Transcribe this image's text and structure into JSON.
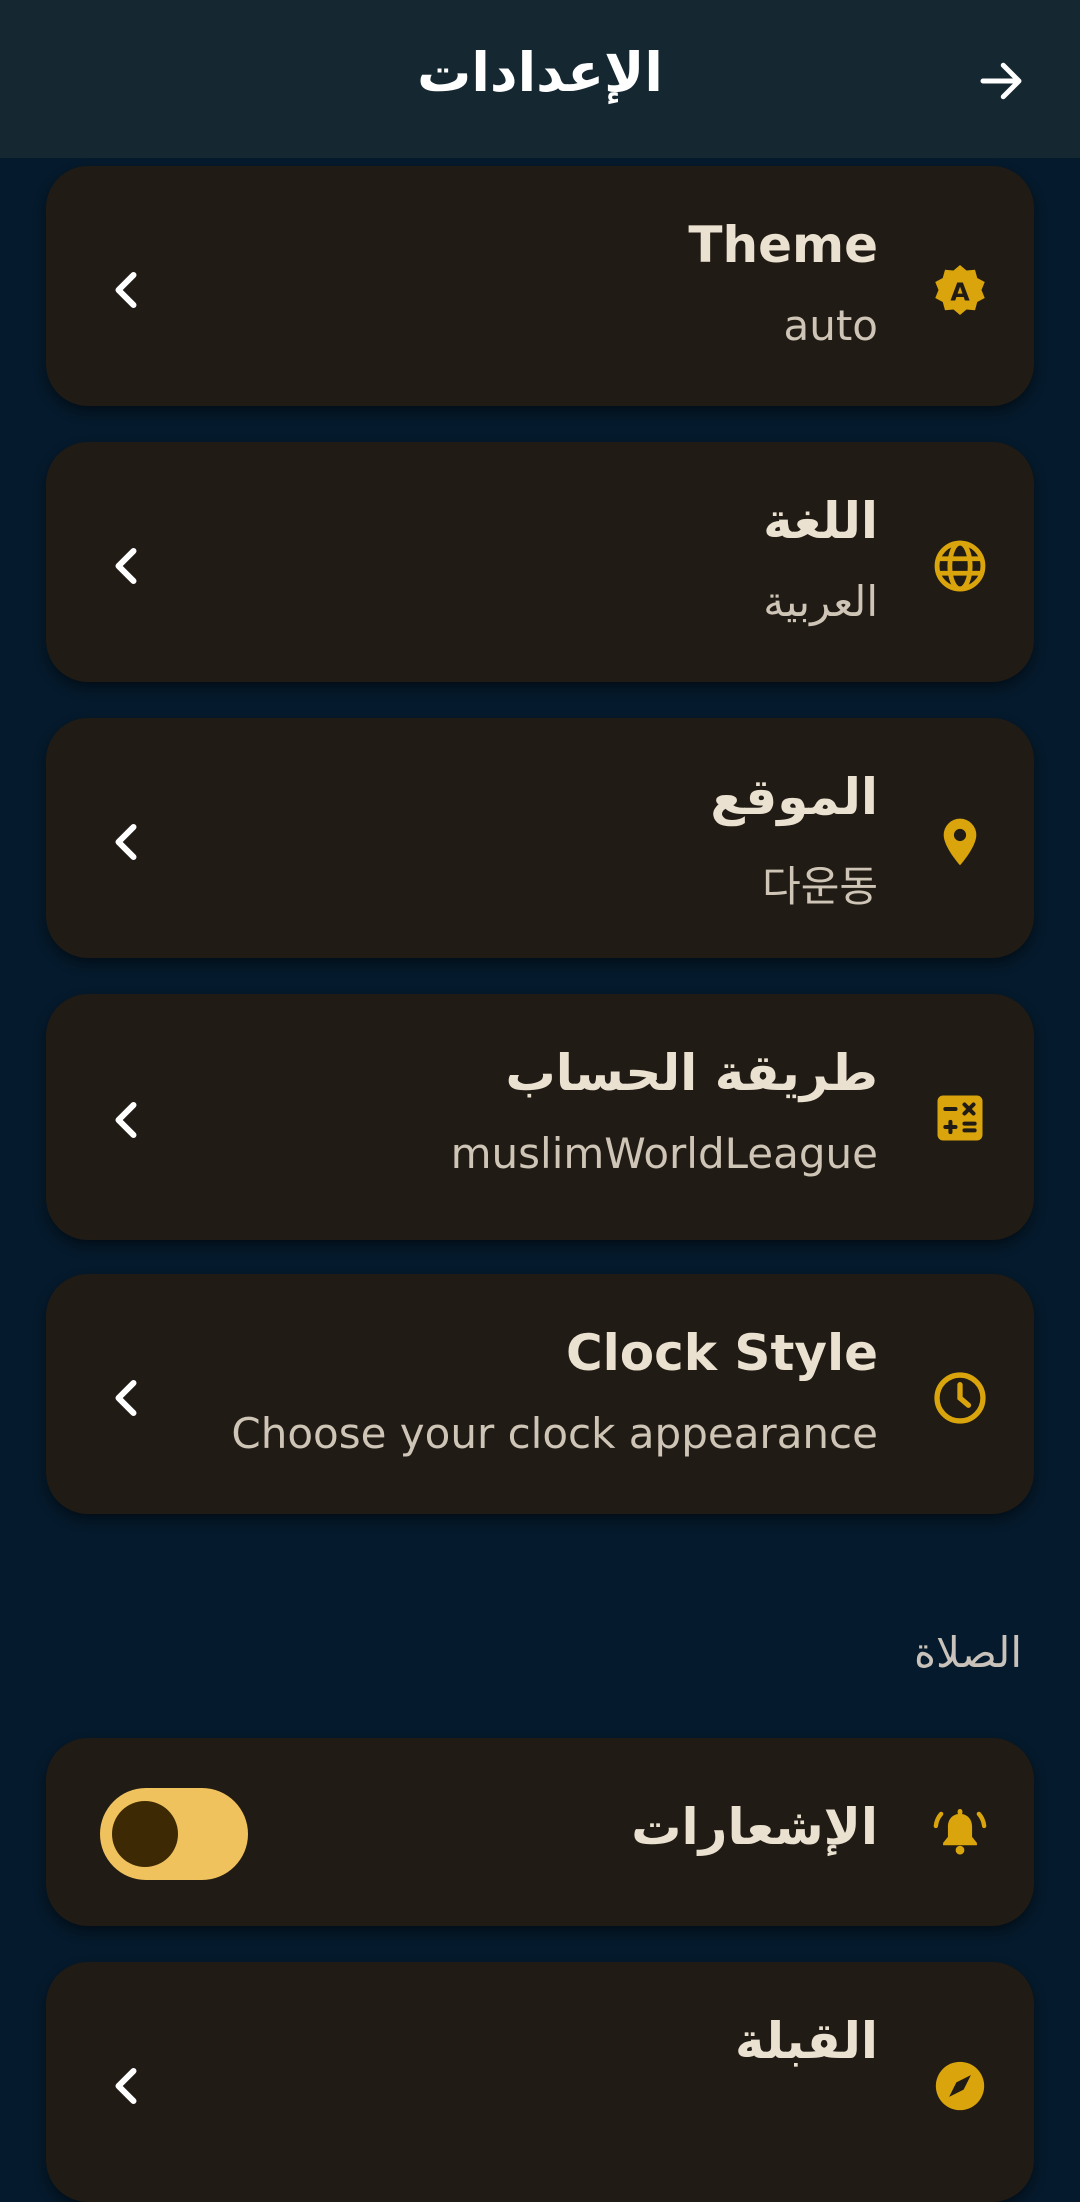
{
  "appbar": {
    "title": "الإعدادات",
    "back_icon": "arrow-right-icon"
  },
  "settings": [
    {
      "title": "Theme",
      "subtitle": "auto",
      "icon": "theme-auto-icon"
    },
    {
      "title": "اللغة",
      "subtitle": "العربية",
      "icon": "globe-icon"
    },
    {
      "title": "الموقع",
      "subtitle": "다운동",
      "icon": "location-pin-icon"
    },
    {
      "title": "طريقة الحساب",
      "subtitle": "muslimWorldLeague",
      "icon": "calculator-icon"
    },
    {
      "title": "Clock Style",
      "subtitle": "Choose your clock appearance",
      "icon": "clock-icon"
    }
  ],
  "prayer_section": {
    "header": "الصلاة",
    "notifications": {
      "title": "الإشعارات",
      "icon": "bell-ringing-icon",
      "enabled": true
    },
    "qibla": {
      "title": "القبلة",
      "icon": "compass-icon"
    }
  },
  "colors": {
    "background": "#051a2c",
    "appbar": "#152832",
    "card": "#201b14",
    "accent": "#d9a40c",
    "toggle_on": "#f0c25e"
  }
}
